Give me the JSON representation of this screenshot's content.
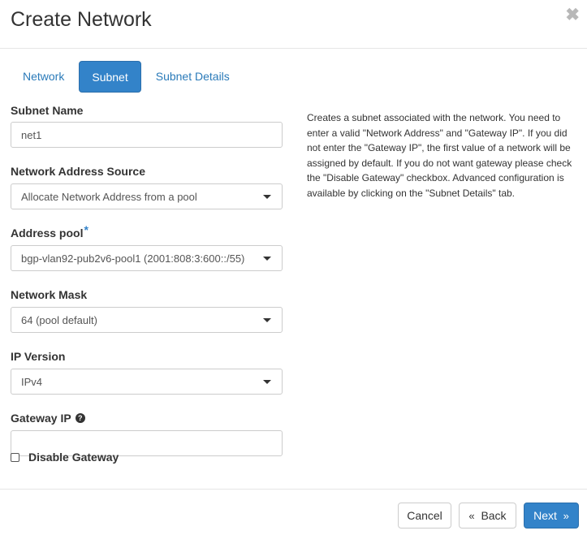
{
  "dialog": {
    "title": "Create Network",
    "close_glyph": "✖"
  },
  "tabs": [
    {
      "label": "Network",
      "active": false
    },
    {
      "label": "Subnet",
      "active": true
    },
    {
      "label": "Subnet Details",
      "active": false
    }
  ],
  "form": {
    "subnet_name": {
      "label": "Subnet Name",
      "value": "net1"
    },
    "address_source": {
      "label": "Network Address Source",
      "value": "Allocate Network Address from a pool"
    },
    "address_pool": {
      "label": "Address pool",
      "required_mark": "*",
      "value": "bgp-vlan92-pub2v6-pool1 (2001:808:3:600::/55)"
    },
    "network_mask": {
      "label": "Network Mask",
      "value": "64 (pool default)"
    },
    "ip_version": {
      "label": "IP Version",
      "value": "IPv4"
    },
    "gateway_ip": {
      "label": "Gateway IP",
      "help_glyph": "?",
      "value": ""
    },
    "disable_gateway": {
      "label": "Disable Gateway",
      "checked": false
    }
  },
  "help_text": "Creates a subnet associated with the network. You need to enter a valid \"Network Address\" and \"Gateway IP\". If you did not enter the \"Gateway IP\", the first value of a network will be assigned by default. If you do not want gateway please check the \"Disable Gateway\" checkbox. Advanced configuration is available by clicking on the \"Subnet Details\" tab.",
  "footer": {
    "cancel_label": "Cancel",
    "back_chevron": "«",
    "back_label": "Back",
    "next_label": "Next",
    "next_chevron": "»"
  },
  "colors": {
    "accent": "#3383c9",
    "link": "#2a7ab9"
  }
}
